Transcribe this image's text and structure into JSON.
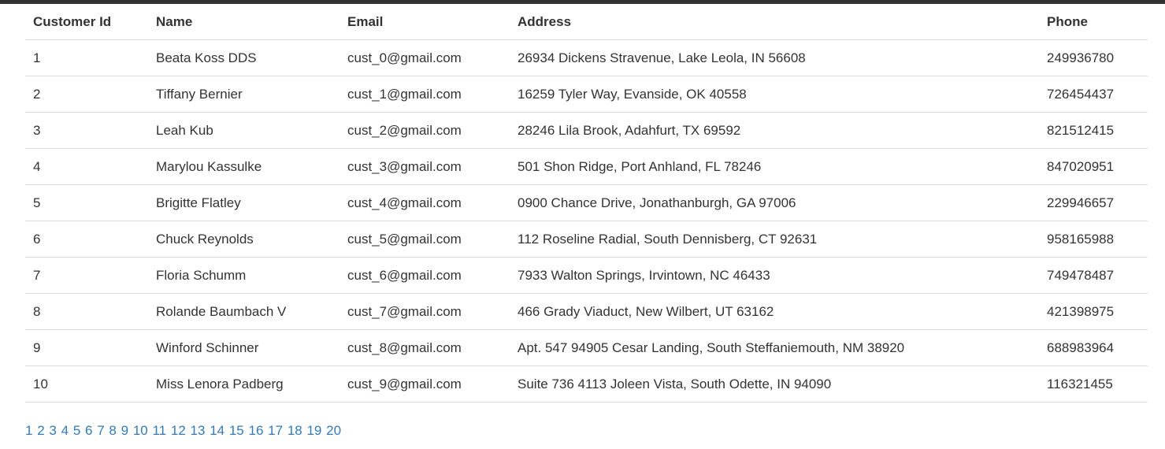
{
  "table": {
    "headers": [
      "Customer Id",
      "Name",
      "Email",
      "Address",
      "Phone"
    ],
    "rows": [
      [
        "1",
        "Beata Koss DDS",
        "cust_0@gmail.com",
        "26934 Dickens Stravenue, Lake Leola, IN 56608",
        "249936780"
      ],
      [
        "2",
        "Tiffany Bernier",
        "cust_1@gmail.com",
        "16259 Tyler Way, Evanside, OK 40558",
        "726454437"
      ],
      [
        "3",
        "Leah Kub",
        "cust_2@gmail.com",
        "28246 Lila Brook, Adahfurt, TX 69592",
        "821512415"
      ],
      [
        "4",
        "Marylou Kassulke",
        "cust_3@gmail.com",
        "501 Shon Ridge, Port Anhland, FL 78246",
        "847020951"
      ],
      [
        "5",
        "Brigitte Flatley",
        "cust_4@gmail.com",
        "0900 Chance Drive, Jonathanburgh, GA 97006",
        "229946657"
      ],
      [
        "6",
        "Chuck Reynolds",
        "cust_5@gmail.com",
        "112 Roseline Radial, South Dennisberg, CT 92631",
        "958165988"
      ],
      [
        "7",
        "Floria Schumm",
        "cust_6@gmail.com",
        "7933 Walton Springs, Irvintown, NC 46433",
        "749478487"
      ],
      [
        "8",
        "Rolande Baumbach V",
        "cust_7@gmail.com",
        "466 Grady Viaduct, New Wilbert, UT 63162",
        "421398975"
      ],
      [
        "9",
        "Winford Schinner",
        "cust_8@gmail.com",
        "Apt. 547 94905 Cesar Landing, South Steffaniemouth, NM 38920",
        "688983964"
      ],
      [
        "10",
        "Miss Lenora Padberg",
        "cust_9@gmail.com",
        "Suite 736 4113 Joleen Vista, South Odette, IN 94090",
        "116321455"
      ]
    ]
  },
  "pagination": {
    "pages": [
      "1",
      "2",
      "3",
      "4",
      "5",
      "6",
      "7",
      "8",
      "9",
      "10",
      "11",
      "12",
      "13",
      "14",
      "15",
      "16",
      "17",
      "18",
      "19",
      "20"
    ]
  },
  "colors": {
    "link": "#337ab7",
    "text": "#333333",
    "border": "#dddddd",
    "top_bar": "#333333"
  }
}
